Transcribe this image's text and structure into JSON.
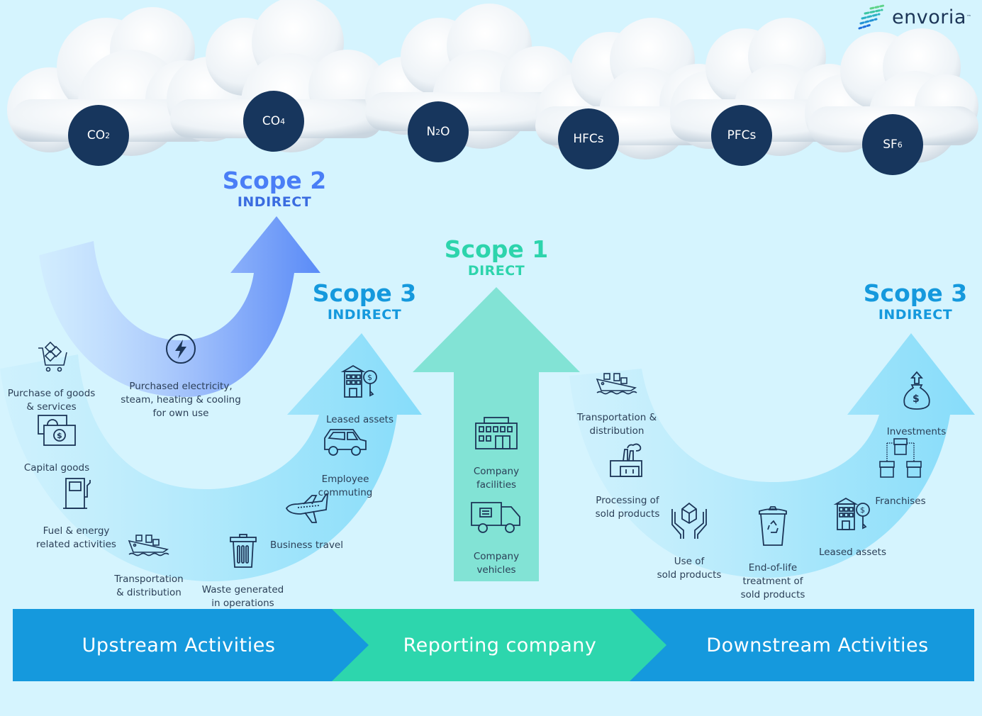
{
  "brand": {
    "name": "envoria",
    "trademark": "™"
  },
  "colors": {
    "background": "#d5f4fe",
    "gas_circle": "#17365d",
    "scope1": "#2dd4ac",
    "scope1_arrow": "#82e3d5",
    "scope2": "#4a7ef6",
    "scope3": "#1599dd",
    "scope3_arrow": "#8be1fb",
    "upstream_band": "#1599dd",
    "reporting_band": "#2dd6ad",
    "downstream_band": "#1599dd",
    "icon_stroke": "#1c3557"
  },
  "gases": [
    {
      "base": "CO",
      "sub": "2",
      "suffix": ""
    },
    {
      "base": "CO",
      "sub": "4",
      "suffix": ""
    },
    {
      "base": "N",
      "sub": "2",
      "suffix": "O"
    },
    {
      "base": "HFCs",
      "sub": "",
      "suffix": ""
    },
    {
      "base": "PFCs",
      "sub": "",
      "suffix": ""
    },
    {
      "base": "SF",
      "sub": "6",
      "suffix": ""
    }
  ],
  "scopes": {
    "scope2": {
      "title": "Scope 2",
      "subtitle": "INDIRECT"
    },
    "scope1": {
      "title": "Scope 1",
      "subtitle": "DIRECT"
    },
    "scope3_upstream": {
      "title": "Scope 3",
      "subtitle": "INDIRECT"
    },
    "scope3_downstream": {
      "title": "Scope 3",
      "subtitle": "INDIRECT"
    }
  },
  "scope2_items": [
    {
      "label": "Purchased electricity,\nsteam, heating & cooling\nfor own use",
      "icon": "lightning-icon"
    }
  ],
  "upstream_items": [
    {
      "label": "Purchase of goods\n& services",
      "icon": "shopping-cart-icon"
    },
    {
      "label": "Capital goods",
      "icon": "money-bills-icon"
    },
    {
      "label": "Fuel & energy\nrelated activities",
      "icon": "fuel-pump-icon"
    },
    {
      "label": "Transportation\n& distribution",
      "icon": "cargo-ship-icon"
    },
    {
      "label": "Waste generated\nin operations",
      "icon": "trash-bin-icon"
    },
    {
      "label": "Business travel",
      "icon": "airplane-icon"
    },
    {
      "label": "Employee\ncommuting",
      "icon": "car-icon"
    },
    {
      "label": "Leased assets",
      "icon": "building-key-icon"
    }
  ],
  "scope1_items": [
    {
      "label": "Company\nfacilities",
      "icon": "factory-building-icon"
    },
    {
      "label": "Company\nvehicles",
      "icon": "delivery-van-icon"
    }
  ],
  "downstream_items": [
    {
      "label": "Transportation &\ndistribution",
      "icon": "cargo-ship-icon"
    },
    {
      "label": "Processing of\nsold products",
      "icon": "factory-icon"
    },
    {
      "label": "Use of\nsold products",
      "icon": "hands-box-icon"
    },
    {
      "label": "End-of-life\ntreatment of\nsold products",
      "icon": "recycle-bin-icon"
    },
    {
      "label": "Leased assets",
      "icon": "building-key-icon"
    },
    {
      "label": "Franchises",
      "icon": "franchise-stores-icon"
    },
    {
      "label": "Investments",
      "icon": "money-bag-icon"
    }
  ],
  "band": {
    "upstream": "Upstream Activities",
    "reporting": "Reporting company",
    "downstream": "Downstream Activities"
  }
}
